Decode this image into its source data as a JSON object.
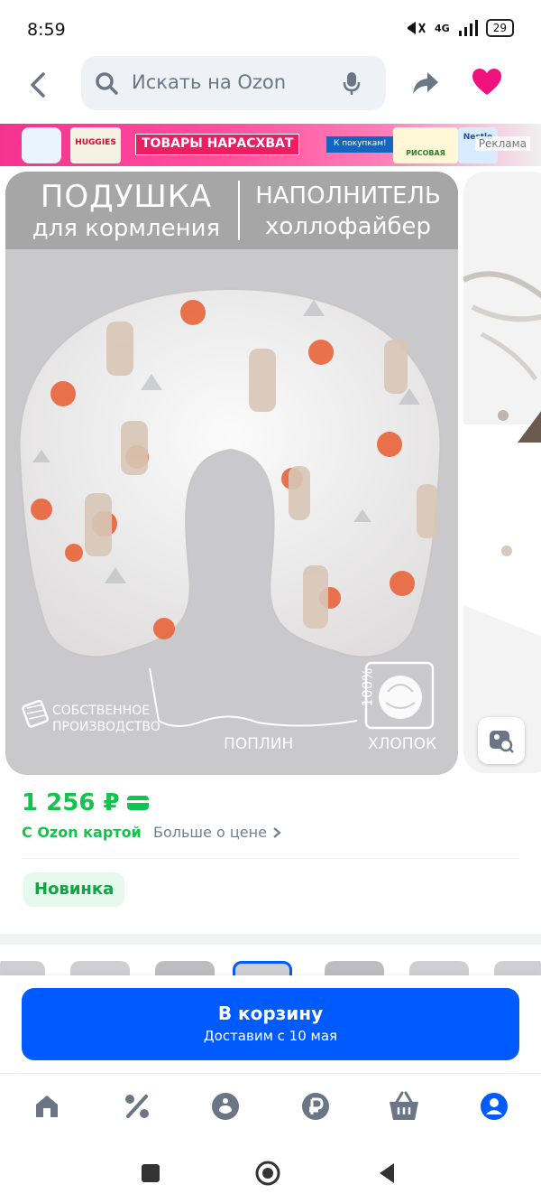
{
  "status_bar": {
    "time": "8:59",
    "network": "4G",
    "battery": "29"
  },
  "search": {
    "placeholder": "Искать на Ozon"
  },
  "ad": {
    "title": "ТОВАРЫ НАРАСХВАТ",
    "button": "К покупкам!",
    "label": "Реклама",
    "brands": [
      "HUGGIES",
      "Nestle",
      "РИСОВАЯ"
    ]
  },
  "product_image": {
    "left_title": "ПОДУШКА",
    "left_subtitle": "для кормления",
    "right_title": "НАПОЛНИТЕЛЬ",
    "right_subtitle": "холлофайбер",
    "production_line1": "СОБСТВЕННОЕ",
    "production_line2": "ПРОИЗВОДСТВО",
    "fabric": "ПОПЛИН",
    "cotton": "ХЛОПОК",
    "cotton_percent": "100%"
  },
  "price": {
    "value": "1 256 ₽",
    "ozon_card": "С Ozon картой",
    "more": "Больше о цене"
  },
  "badge": {
    "new": "Новинка"
  },
  "cart": {
    "title": "В корзину",
    "delivery": "Доставим с 10 мая"
  },
  "colors": {
    "accent": "#005bff",
    "price": "#10c44c",
    "favorite": "#f1117e"
  },
  "icons": {
    "nav": [
      "home-icon",
      "discount-icon",
      "fresh-icon",
      "points-icon",
      "basket-icon",
      "profile-icon"
    ]
  }
}
